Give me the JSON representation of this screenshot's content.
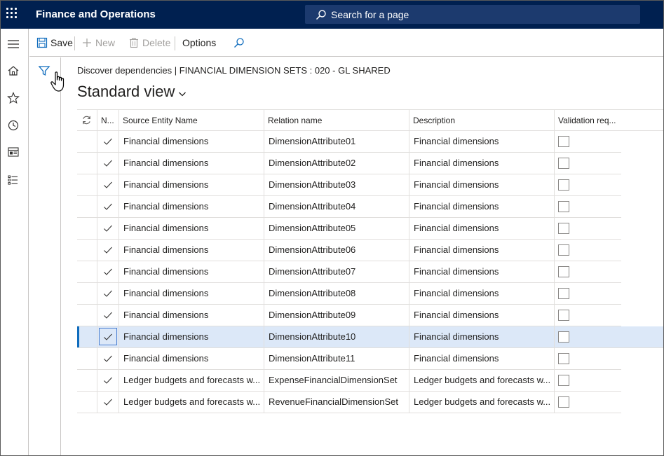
{
  "app": {
    "title": "Finance and Operations"
  },
  "search": {
    "placeholder": "Search for a page"
  },
  "actions": {
    "save": "Save",
    "new": "New",
    "delete": "Delete",
    "options": "Options"
  },
  "breadcrumb": "Discover dependencies  |  FINANCIAL DIMENSION SETS : 020 - GL SHARED",
  "view": {
    "title": "Standard view"
  },
  "grid": {
    "headers": [
      "N...",
      "Source Entity Name",
      "Relation name",
      "Description",
      "Validation req..."
    ],
    "rows": [
      {
        "source": "Financial dimensions",
        "relation": "DimensionAttribute01",
        "description": "Financial dimensions",
        "checked_n": true,
        "validation": false,
        "selected": false
      },
      {
        "source": "Financial dimensions",
        "relation": "DimensionAttribute02",
        "description": "Financial dimensions",
        "checked_n": true,
        "validation": false,
        "selected": false
      },
      {
        "source": "Financial dimensions",
        "relation": "DimensionAttribute03",
        "description": "Financial dimensions",
        "checked_n": true,
        "validation": false,
        "selected": false
      },
      {
        "source": "Financial dimensions",
        "relation": "DimensionAttribute04",
        "description": "Financial dimensions",
        "checked_n": true,
        "validation": false,
        "selected": false
      },
      {
        "source": "Financial dimensions",
        "relation": "DimensionAttribute05",
        "description": "Financial dimensions",
        "checked_n": true,
        "validation": false,
        "selected": false
      },
      {
        "source": "Financial dimensions",
        "relation": "DimensionAttribute06",
        "description": "Financial dimensions",
        "checked_n": true,
        "validation": false,
        "selected": false
      },
      {
        "source": "Financial dimensions",
        "relation": "DimensionAttribute07",
        "description": "Financial dimensions",
        "checked_n": true,
        "validation": false,
        "selected": false
      },
      {
        "source": "Financial dimensions",
        "relation": "DimensionAttribute08",
        "description": "Financial dimensions",
        "checked_n": true,
        "validation": false,
        "selected": false
      },
      {
        "source": "Financial dimensions",
        "relation": "DimensionAttribute09",
        "description": "Financial dimensions",
        "checked_n": true,
        "validation": false,
        "selected": false
      },
      {
        "source": "Financial dimensions",
        "relation": "DimensionAttribute10",
        "description": "Financial dimensions",
        "checked_n": true,
        "validation": false,
        "selected": true
      },
      {
        "source": "Financial dimensions",
        "relation": "DimensionAttribute11",
        "description": "Financial dimensions",
        "checked_n": true,
        "validation": false,
        "selected": false
      },
      {
        "source": "Ledger budgets and forecasts w...",
        "relation": "ExpenseFinancialDimensionSet",
        "description": "Ledger budgets and forecasts w...",
        "checked_n": true,
        "validation": false,
        "selected": false
      },
      {
        "source": "Ledger budgets and forecasts w...",
        "relation": "RevenueFinancialDimensionSet",
        "description": "Ledger budgets and forecasts w...",
        "checked_n": true,
        "validation": false,
        "selected": false
      }
    ]
  },
  "icons": {
    "waffle": "waffle-icon",
    "search": "search-icon",
    "save": "save-icon",
    "new": "plus-icon",
    "delete": "trash-icon",
    "find": "search-icon",
    "filter": "filter-icon",
    "hamburger": "hamburger-icon",
    "home": "home-icon",
    "favorites": "star-icon",
    "recent": "clock-icon",
    "workspaces": "workspace-icon",
    "modules": "list-icon",
    "refresh": "refresh-icon",
    "checkmark": "checkmark-icon",
    "chevron": "chevron-down-icon"
  },
  "colors": {
    "topbar": "#002050",
    "accent": "#0f6cbd",
    "selected_row": "#dce8f8"
  }
}
